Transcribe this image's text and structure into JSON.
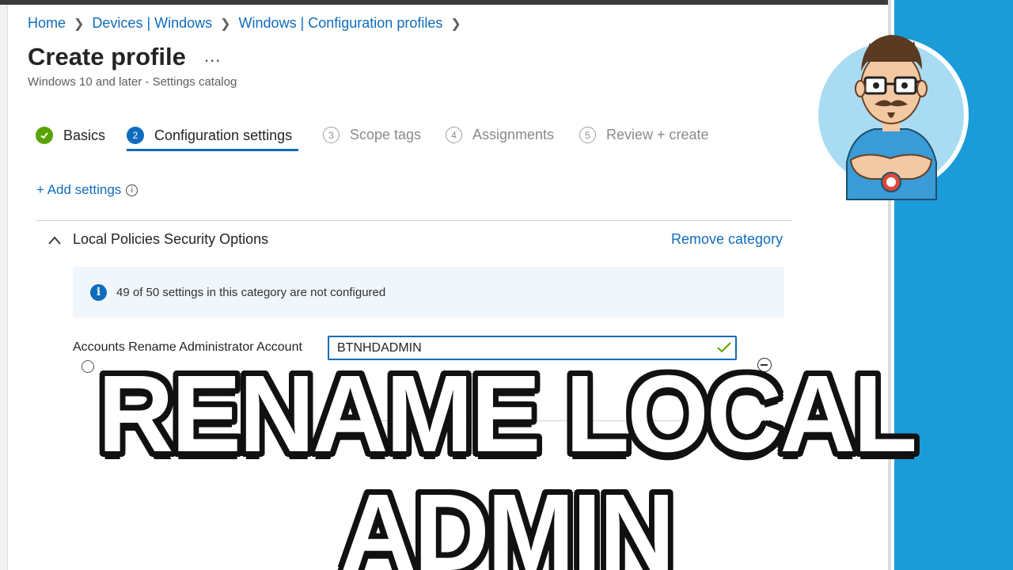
{
  "breadcrumb": {
    "items": [
      "Home",
      "Devices | Windows",
      "Windows | Configuration profiles"
    ],
    "separator": ">"
  },
  "header": {
    "title": "Create profile",
    "more_label": "...",
    "subtitle": "Windows 10 and later - Settings catalog"
  },
  "steps": [
    {
      "number": "✓",
      "label": "Basics",
      "state": "done"
    },
    {
      "number": "2",
      "label": "Configuration settings",
      "state": "active"
    },
    {
      "number": "3",
      "label": "Scope tags",
      "state": "pending"
    },
    {
      "number": "4",
      "label": "Assignments",
      "state": "pending"
    },
    {
      "number": "5",
      "label": "Review + create",
      "state": "pending"
    }
  ],
  "actions": {
    "add_settings": "+ Add settings"
  },
  "category": {
    "title": "Local Policies Security Options",
    "remove_label": "Remove category",
    "banner_text": "49 of 50 settings in this category are not configured"
  },
  "setting": {
    "label": "Accounts Rename Administrator Account",
    "value": "BTNHDADMIN"
  },
  "overlay": {
    "title": "RENAME LOCAL ADMIN"
  },
  "colors": {
    "accent": "#0f6cbd",
    "success": "#57a300",
    "side_panel": "#1b9bd8"
  }
}
